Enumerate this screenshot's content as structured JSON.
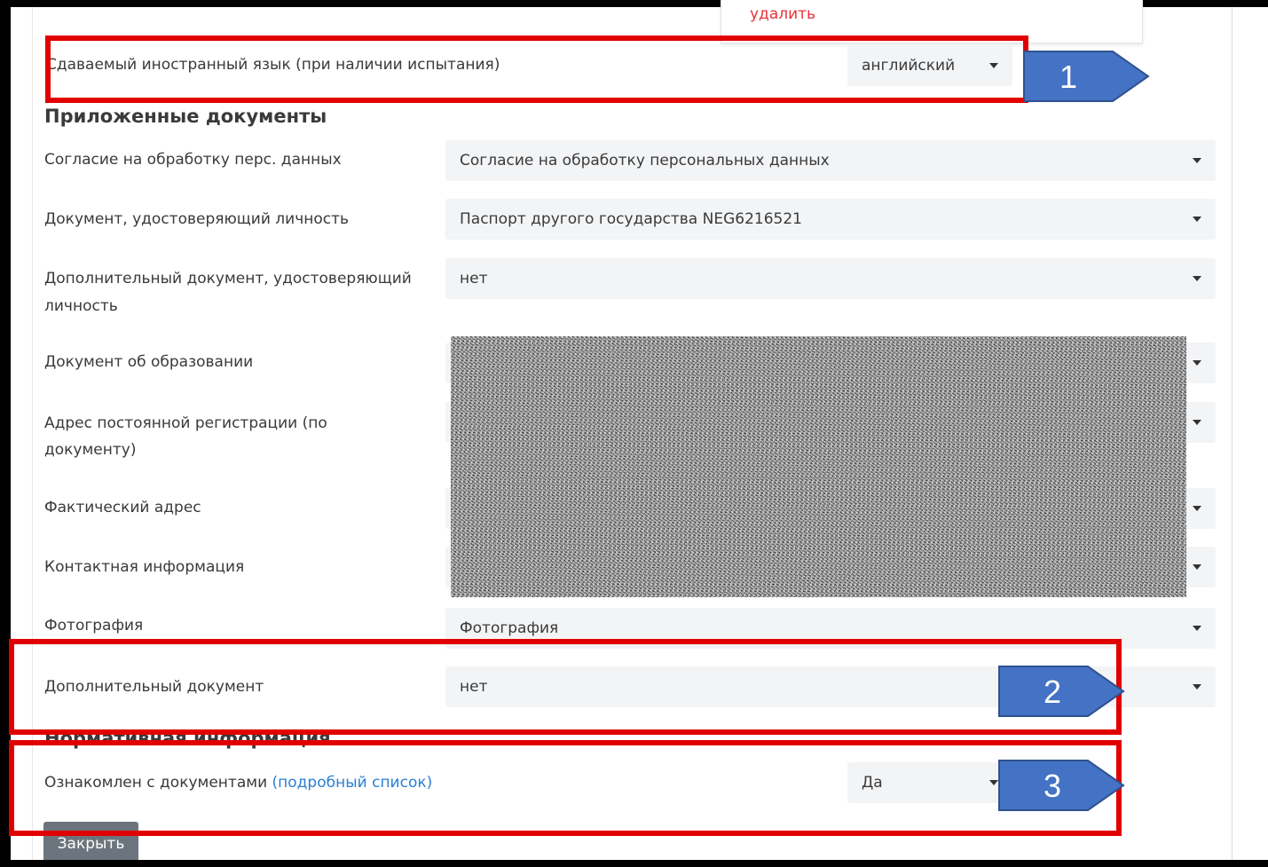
{
  "popup": {
    "delete_label": "удалить"
  },
  "language_row": {
    "label": "Сдаваемый иностранный язык (при наличии испытания)",
    "value": "английский"
  },
  "attached_documents": {
    "title": "Приложенные документы",
    "rows": [
      {
        "label": "Согласие на обработку перс. данных",
        "value": "Согласие на обработку персональных данных"
      },
      {
        "label": "Документ, удостоверяющий личность",
        "value": "Паспорт другого государства NEG6216521"
      },
      {
        "label": "Дополнительный документ, удостоверяющий",
        "label2": "личность",
        "value": "нет"
      },
      {
        "label": "Документ об образовании"
      },
      {
        "label": "Адрес постоянной регистрации (по",
        "label2": "документу)"
      },
      {
        "label": "Фактический адрес"
      },
      {
        "label": "Контактная информация"
      },
      {
        "label": "Фотография",
        "value": "Фотография"
      },
      {
        "label": "Дополнительный документ",
        "value": "нет"
      }
    ]
  },
  "normative": {
    "title": "Нормативная информация",
    "label": "Ознакомлен с документами",
    "link": "(подробный список)",
    "value": "Да"
  },
  "close_button": "Закрыть",
  "annotations": {
    "one": "1",
    "two": "2",
    "three": "3"
  },
  "colors": {
    "annotation_box": "#e10000",
    "callout_fill": "#4472c4",
    "link": "#2a7fd4"
  }
}
